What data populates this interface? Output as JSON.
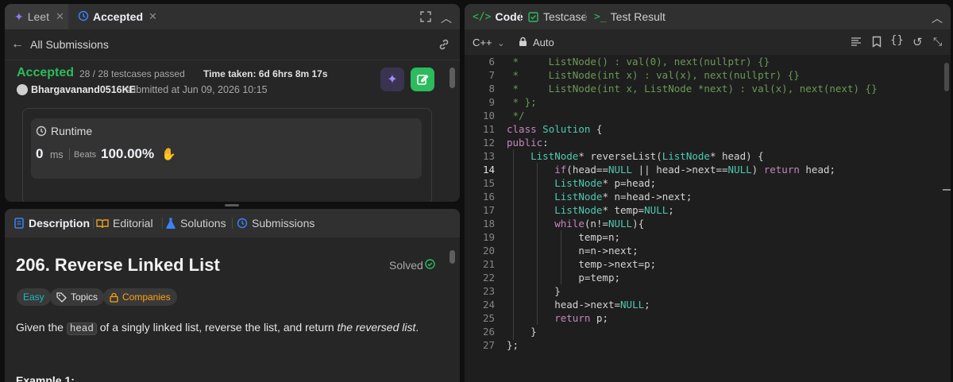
{
  "left_top": {
    "tabs": [
      {
        "label": "Leet",
        "icon": "sparkle-icon"
      },
      {
        "label": "Accepted",
        "icon": "history-icon"
      }
    ],
    "back_label": "All Submissions",
    "status": "Accepted",
    "testcases": "28 / 28 testcases passed",
    "time_taken": "Time taken: 6d 6hrs 8m 17s",
    "username": "Bhargavanand0516KE",
    "submitted_text": "submitted at Jun 09, 2026 10:15",
    "runtime_title": "Runtime",
    "runtime_value": "0",
    "runtime_unit": "ms",
    "beats_label": "Beats",
    "beats_value": "100.00%",
    "colors": {
      "accepted": "#2cbb5d",
      "edit_button": "#2cbb5d",
      "ai_button": "#3a3450"
    }
  },
  "left_bottom": {
    "tabs": [
      {
        "label": "Description",
        "icon": "document-icon"
      },
      {
        "label": "Editorial",
        "icon": "book-icon"
      },
      {
        "label": "Solutions",
        "icon": "flask-icon"
      },
      {
        "label": "Submissions",
        "icon": "history-icon"
      }
    ],
    "problem_title": "206. Reverse Linked List",
    "solved_label": "Solved",
    "difficulty": "Easy",
    "topics": "Topics",
    "companies": "Companies",
    "desc_before": "Given the ",
    "desc_code": "head",
    "desc_middle": " of a singly linked list, reverse the list, and return ",
    "desc_italic": "the reversed list",
    "desc_end": ".",
    "example_heading": "Example 1:"
  },
  "right": {
    "tabs": [
      {
        "label": "Code",
        "icon": "code-icon"
      },
      {
        "label": "Testcase",
        "icon": "checkbox-icon"
      },
      {
        "label": "Test Result",
        "icon": "terminal-icon"
      }
    ],
    "language": "C++",
    "mode": "Auto",
    "active_line": 14,
    "code_lines": [
      {
        "n": 6,
        "text": " *     ListNode() : val(0), next(nullptr) {}",
        "kind": "comment"
      },
      {
        "n": 7,
        "text": " *     ListNode(int x) : val(x), next(nullptr) {}",
        "kind": "comment"
      },
      {
        "n": 8,
        "text": " *     ListNode(int x, ListNode *next) : val(x), next(next) {}",
        "kind": "comment"
      },
      {
        "n": 9,
        "text": " * };",
        "kind": "comment"
      },
      {
        "n": 10,
        "text": " */",
        "kind": "comment"
      },
      {
        "n": 11,
        "text": "class Solution {",
        "kind": "code"
      },
      {
        "n": 12,
        "text": "public:",
        "kind": "code"
      },
      {
        "n": 13,
        "text": "    ListNode* reverseList(ListNode* head) {",
        "kind": "code"
      },
      {
        "n": 14,
        "text": "        if(head==NULL || head->next==NULL) return head;",
        "kind": "code"
      },
      {
        "n": 15,
        "text": "        ListNode* p=head;",
        "kind": "code"
      },
      {
        "n": 16,
        "text": "        ListNode* n=head->next;",
        "kind": "code"
      },
      {
        "n": 17,
        "text": "        ListNode* temp=NULL;",
        "kind": "code"
      },
      {
        "n": 18,
        "text": "        while(n!=NULL){",
        "kind": "code"
      },
      {
        "n": 19,
        "text": "            temp=n;",
        "kind": "code"
      },
      {
        "n": 20,
        "text": "            n=n->next;",
        "kind": "code"
      },
      {
        "n": 21,
        "text": "            temp->next=p;",
        "kind": "code"
      },
      {
        "n": 22,
        "text": "            p=temp;",
        "kind": "code"
      },
      {
        "n": 23,
        "text": "        }",
        "kind": "code"
      },
      {
        "n": 24,
        "text": "        head->next=NULL;",
        "kind": "code"
      },
      {
        "n": 25,
        "text": "        return p;",
        "kind": "code"
      },
      {
        "n": 26,
        "text": "    }",
        "kind": "code"
      },
      {
        "n": 27,
        "text": "};",
        "kind": "code"
      }
    ]
  }
}
